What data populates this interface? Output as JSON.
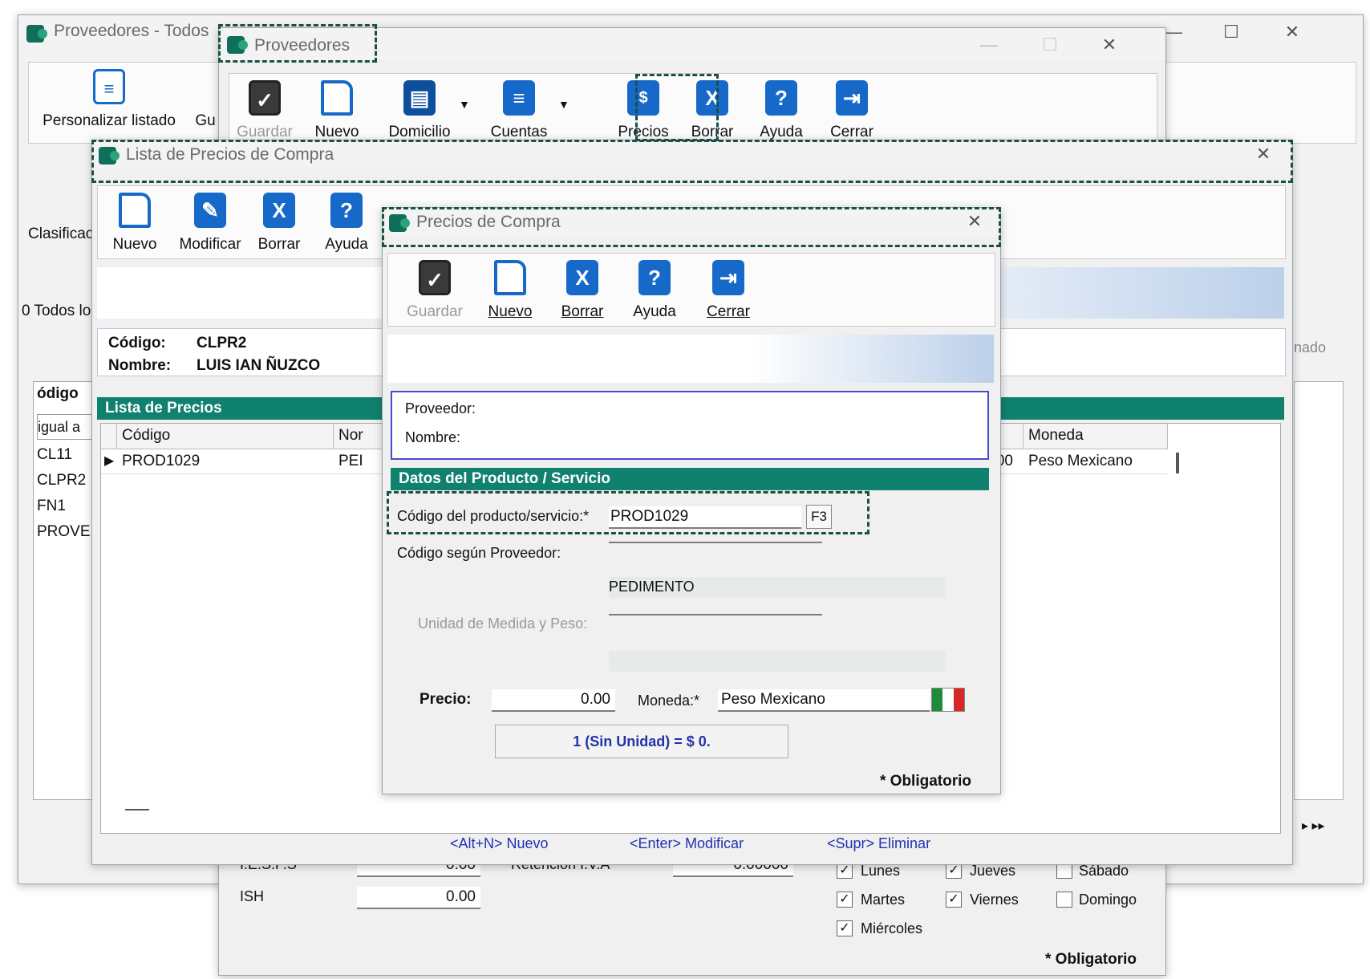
{
  "back_window": {
    "title": "Proveedores - Todos",
    "toolbar": {
      "personalizar": "Personalizar listado",
      "gu": "Gu"
    },
    "clasificacion": "Clasificac",
    "todos": "0 Todos lo",
    "codigo_col": "ódigo",
    "filter": "igual a",
    "rows": [
      "CL11",
      "CLPR2",
      "FN1",
      "PROVE"
    ],
    "nado": "inado"
  },
  "proveedores_window": {
    "title": "Proveedores",
    "toolbar": {
      "guardar": "Guardar",
      "nuevo": "Nuevo",
      "domicilio": "Domicilio",
      "cuentas": "Cuentas",
      "precios": "Precios",
      "borrar": "Borrar",
      "ayuda": "Ayuda",
      "cerrar": "Cerrar"
    },
    "ieps_label": "I.E.S.P.S",
    "ieps_value": "0.00",
    "ish_label": "ISH",
    "ish_value": "0.00",
    "retencion_label": "Retención I.V.A",
    "retencion_value": "0.00000",
    "days": [
      {
        "label": "Lunes",
        "checked": true
      },
      {
        "label": "Jueves",
        "checked": true
      },
      {
        "label": "Sábado",
        "checked": false
      },
      {
        "label": "Martes",
        "checked": true
      },
      {
        "label": "Viernes",
        "checked": true
      },
      {
        "label": "Domingo",
        "checked": false
      },
      {
        "label": "Miércoles",
        "checked": true
      }
    ],
    "obligatorio": "* Obligatorio"
  },
  "lista_window": {
    "title": "Lista de Precios de Compra",
    "toolbar": {
      "nuevo": "Nuevo",
      "modificar": "Modificar",
      "borrar": "Borrar",
      "ayuda": "Ayuda"
    },
    "codigo_label": "Código:",
    "codigo_value": "CLPR2",
    "nombre_label": "Nombre:",
    "nombre_value": "LUIS IAN ÑUZCO",
    "section": "Lista de Precios",
    "columns": {
      "codigo": "Código",
      "nombre": "Nor",
      "moneda": "Moneda"
    },
    "row": {
      "codigo": "PROD1029",
      "nombre": "PEI",
      "precio": "0.00",
      "moneda": "Peso Mexicano"
    },
    "hints": {
      "nuevo": "<Alt+N> Nuevo",
      "modificar": "<Enter> Modificar",
      "eliminar": "<Supr> Eliminar"
    }
  },
  "precios_window": {
    "title": "Precios de Compra",
    "toolbar": {
      "guardar": "Guardar",
      "nuevo": "Nuevo",
      "borrar": "Borrar",
      "ayuda": "Ayuda",
      "cerrar": "Cerrar"
    },
    "proveedor_label": "Proveedor:",
    "nombre_label": "Nombre:",
    "section": "Datos del Producto / Servicio",
    "codigo_label": "Código del producto/servicio:*",
    "codigo_value": "PROD1029",
    "f3": "F3",
    "codigo_proveedor_label": "Código según Proveedor:",
    "codigo_proveedor_value": "",
    "pedimento": "PEDIMENTO",
    "unidad_label": "Unidad de Medida y Peso:",
    "precio_label": "Precio:",
    "precio_value": "0.00",
    "moneda_label": "Moneda:*",
    "moneda_value": "Peso Mexicano",
    "conversion": "1 (Sin Unidad) = $ 0.",
    "obligatorio": "* Obligatorio"
  },
  "colors": {
    "accent_teal": "#10806f",
    "highlight_dash": "#1b4f47",
    "icon_blue": "#1669c8"
  }
}
